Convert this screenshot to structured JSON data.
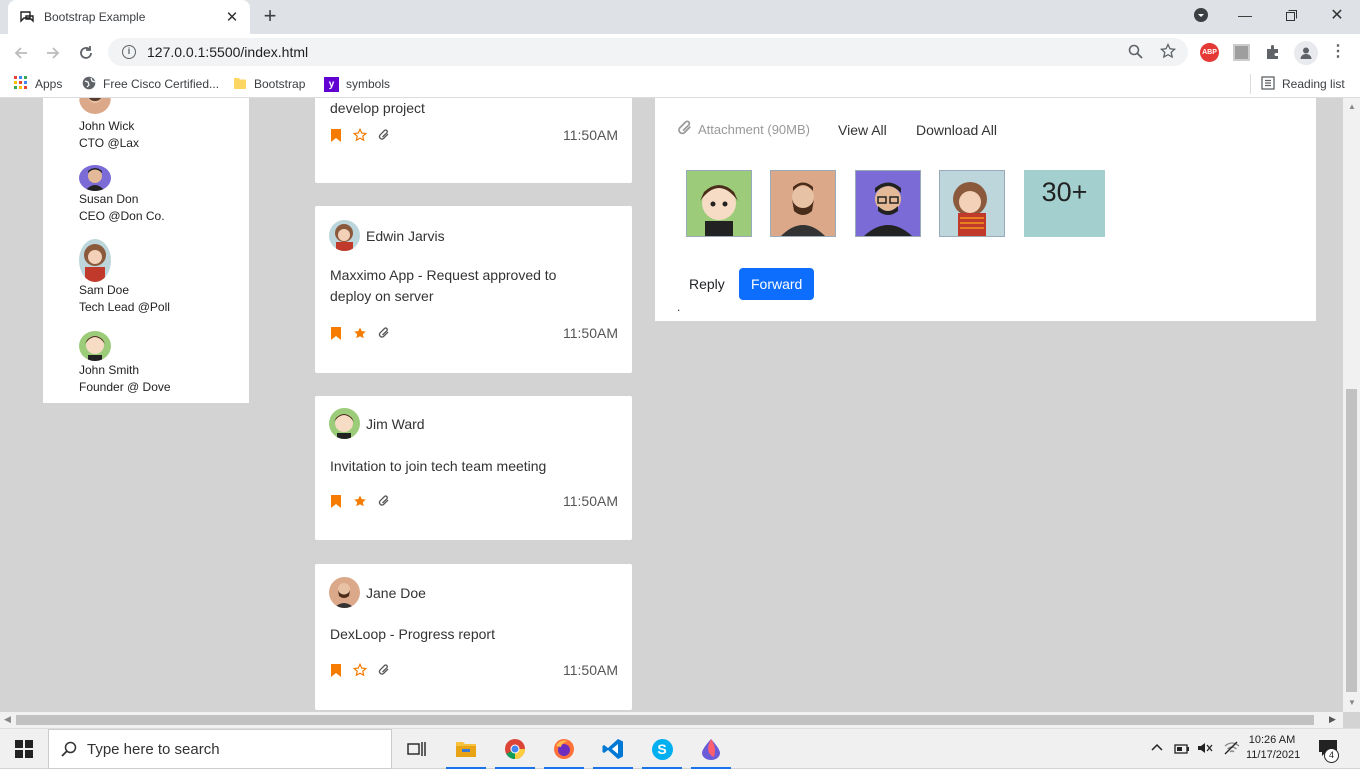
{
  "browser": {
    "tab_title": "Bootstrap Example",
    "url": "127.0.0.1:5500/index.html",
    "bookmarks": [
      "Apps",
      "Free Cisco Certified...",
      "Bootstrap",
      "symbols"
    ],
    "reading_list": "Reading list",
    "abp_label": "ABP"
  },
  "contacts": [
    {
      "name": "John Wick",
      "role": "CTO @Lax"
    },
    {
      "name": "Susan Don",
      "role": "CEO @Don Co."
    },
    {
      "name": "Sam Doe",
      "role": "Tech Lead @Poll"
    },
    {
      "name": "John Smith",
      "role": "Founder @ Dove"
    }
  ],
  "messages": [
    {
      "sender": "",
      "subject": "develop project",
      "time": "11:50AM",
      "starred": false
    },
    {
      "sender": "Edwin Jarvis",
      "subject": "Maxximo App - Request approved to deploy on server",
      "time": "11:50AM",
      "starred": true
    },
    {
      "sender": "Jim Ward",
      "subject": "Invitation to join tech team meeting",
      "time": "11:50AM",
      "starred": true
    },
    {
      "sender": "Jane Doe",
      "subject": "DexLoop - Progress report",
      "time": "11:50AM",
      "starred": false
    }
  ],
  "detail": {
    "attachment_label": "Attachment (90MB)",
    "view_all": "View All",
    "download_all": "Download All",
    "more_count": "30+",
    "reply": "Reply",
    "forward": "Forward",
    "dot": "."
  },
  "taskbar": {
    "search_placeholder": "Type here to search",
    "time": "10:26 AM",
    "date": "11/17/2021",
    "notification_count": "4"
  },
  "colors": {
    "accent": "#0d6efd",
    "bookmark_orange": "#f57c00",
    "page_bg": "#d3d3d3"
  }
}
